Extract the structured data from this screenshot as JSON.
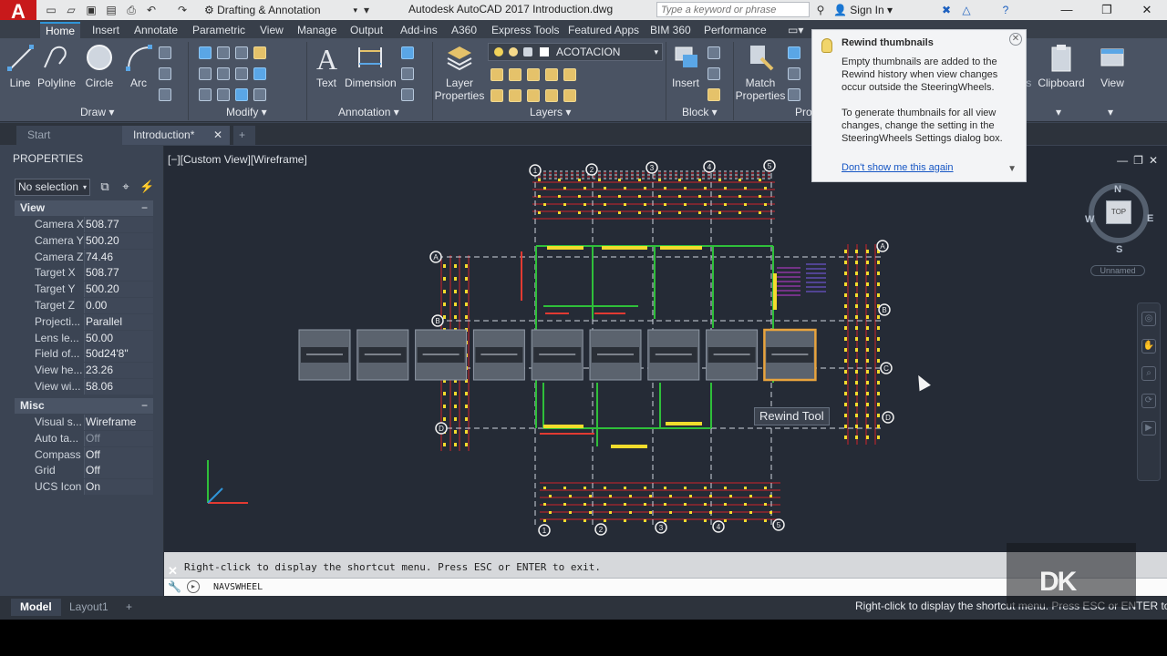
{
  "titlebar": {
    "workspace": "Drafting & Annotation",
    "title": "Autodesk AutoCAD 2017    Introduction.dwg",
    "search_placeholder": "Type a keyword or phrase",
    "sign_in": "Sign In",
    "app_letter": "A"
  },
  "ribbon": {
    "tabs": [
      "Home",
      "Insert",
      "Annotate",
      "Parametric",
      "View",
      "Manage",
      "Output",
      "Add-ins",
      "A360",
      "Express Tools",
      "Featured Apps",
      "BIM 360",
      "Performance"
    ],
    "active_tab": "Home",
    "draw_tools": [
      "Line",
      "Polyline",
      "Circle",
      "Arc"
    ],
    "panels": {
      "draw": "Draw",
      "modify": "Modify",
      "annotation": "Annotation",
      "layers": "Layers",
      "block": "Block",
      "properties": "Properties"
    },
    "annotation_tools": [
      "Text",
      "Dimension"
    ],
    "layer_properties": "Layer\nProperties",
    "layer_name": "ACOTACION",
    "insert": "Insert",
    "match_properties": "Match\nProperties",
    "clipboard": "Clipboard",
    "view": "View",
    "utilities": "Utilities"
  },
  "file_tabs": [
    "Start",
    "Introduction*"
  ],
  "properties": {
    "title": "PROPERTIES",
    "selection": "No selection",
    "view_section": "View",
    "view_rows": [
      {
        "label": "Camera X",
        "value": "508.77"
      },
      {
        "label": "Camera Y",
        "value": "500.20"
      },
      {
        "label": "Camera Z",
        "value": "74.46"
      },
      {
        "label": "Target X",
        "value": "508.77"
      },
      {
        "label": "Target Y",
        "value": "500.20"
      },
      {
        "label": "Target Z",
        "value": "0.00"
      },
      {
        "label": "Projecti...",
        "value": "Parallel"
      },
      {
        "label": "Lens le...",
        "value": "50.00"
      },
      {
        "label": "Field of...",
        "value": "50d24'8\""
      },
      {
        "label": "View he...",
        "value": "23.26"
      },
      {
        "label": "View wi...",
        "value": "58.06"
      }
    ],
    "misc_section": "Misc",
    "misc_rows": [
      {
        "label": "Visual s...",
        "value": "Wireframe",
        "dim": false
      },
      {
        "label": "Auto ta...",
        "value": "Off",
        "dim": true
      },
      {
        "label": "Compass",
        "value": "Off",
        "dim": false
      },
      {
        "label": "Grid",
        "value": "Off",
        "dim": false
      },
      {
        "label": "UCS Icon",
        "value": "On",
        "dim": false
      }
    ]
  },
  "viewport": {
    "label": "[−][Custom View][Wireframe]",
    "tooltip": "Rewind Tool",
    "viewcube": {
      "top": "TOP",
      "n": "N",
      "s": "S",
      "e": "E",
      "w": "W",
      "wcs": "Unnamed"
    },
    "thumbnail_count": 9,
    "selected_thumbnail": 9
  },
  "balloon": {
    "title": "Rewind thumbnails",
    "body1": "Empty thumbnails are added to the Rewind history when view changes occur outside the SteeringWheels.",
    "body2": "To generate thumbnails for all view changes, change the setting in the SteeringWheels Settings dialog box.",
    "link": "Don't show me this again"
  },
  "command": {
    "history": "Right-click to display the shortcut menu. Press ESC or ENTER to exit.",
    "input": "NAVSWHEEL"
  },
  "layout_tabs": [
    "Model",
    "Layout1"
  ],
  "status_message": "Right-click to display the shortcut menu. Press ESC or ENTER to exit.",
  "colors": {
    "accent": "#2f95d8",
    "app_red": "#c8191b",
    "selected_thumb": "#e8a33d"
  }
}
